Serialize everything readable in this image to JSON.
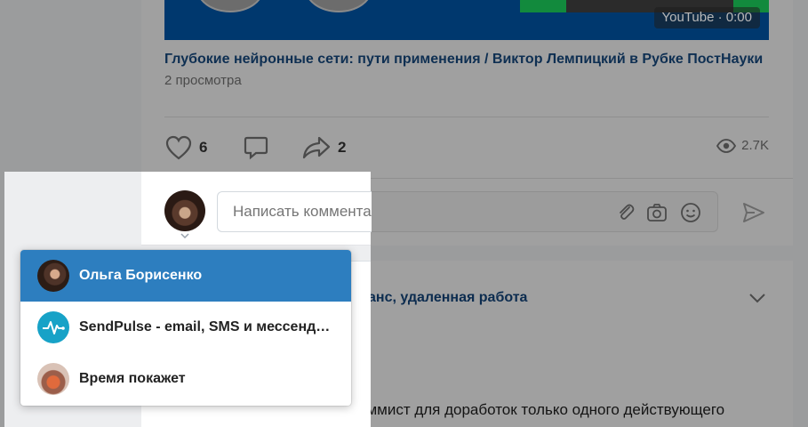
{
  "video": {
    "badge": "YouTube · 0:00",
    "title": "Глубокие нейронные сети: пути применения / Виктор Лемпицкий в Рубке ПостНауки",
    "views": "2 просмотра"
  },
  "actions": {
    "likes": "6",
    "shares": "2",
    "views": "2.7K"
  },
  "comment": {
    "placeholder": "Написать комментарий..."
  },
  "identity_dropdown": {
    "items": [
      {
        "label": "Ольга Борисенко",
        "avatar": "user-photo",
        "selected": true
      },
      {
        "label": "SendPulse - email, SMS и мессендж…",
        "avatar": "sendpulse-logo",
        "selected": false
      },
      {
        "label": "Время покажет",
        "avatar": "community-photo",
        "selected": false
      }
    ]
  },
  "next_post": {
    "title_fragment": "иланс, удаленная работа",
    "link_fragment": "а",
    "text_fragment": "Требуется WordPress программист для доработок только одного действующего"
  },
  "colors": {
    "accent": "#2d7ebf",
    "dim_overlay": "#9b9c9d",
    "sendpulse": "#17a2c7"
  }
}
